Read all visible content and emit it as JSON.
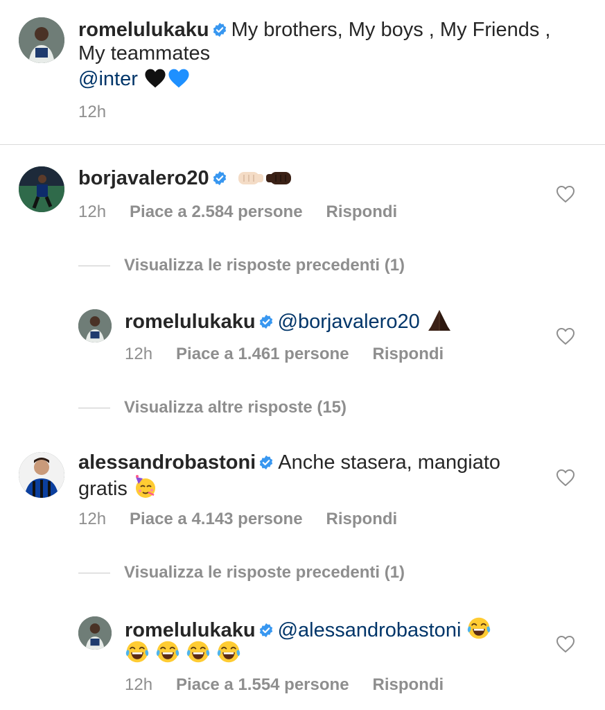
{
  "colors": {
    "link": "#003569",
    "meta": "#8e8e8e",
    "verified": "#3897f0",
    "divider": "#dbdbdb"
  },
  "caption": {
    "username": "romelulukaku",
    "text_line1": "My brothers, My boys , My Friends ,",
    "text_line2": "My teammates",
    "mention": "@inter",
    "emojis": "black-heart, blue-heart",
    "time": "12h"
  },
  "comments": [
    {
      "username": "borjavalero20",
      "text": "",
      "emojis": "fist-bump-light, fist-bump-dark",
      "time": "12h",
      "likes": "Piace a 2.584 persone",
      "reply": "Rispondi",
      "view_replies": "Visualizza le risposte precedenti (1)",
      "nested": {
        "username": "romelulukaku",
        "mention": "@borjavalero20",
        "emojis": "folded-hands",
        "time": "12h",
        "likes": "Piace a 1.461 persone",
        "reply": "Rispondi"
      },
      "more_replies": "Visualizza altre risposte (15)"
    },
    {
      "username": "alessandrobastoni",
      "text_line1": "Anche stasera, mangiato",
      "text_line2": "gratis",
      "emojis": "partying-face",
      "time": "12h",
      "likes": "Piace a 4.143 persone",
      "reply": "Rispondi",
      "view_replies": "Visualizza le risposte precedenti (1)",
      "nested": {
        "username": "romelulukaku",
        "mention": "@alessandrobastoni",
        "emojis": "tears-of-joy x5",
        "time": "12h",
        "likes": "Piace a 1.554 persone",
        "reply": "Rispondi"
      }
    }
  ]
}
